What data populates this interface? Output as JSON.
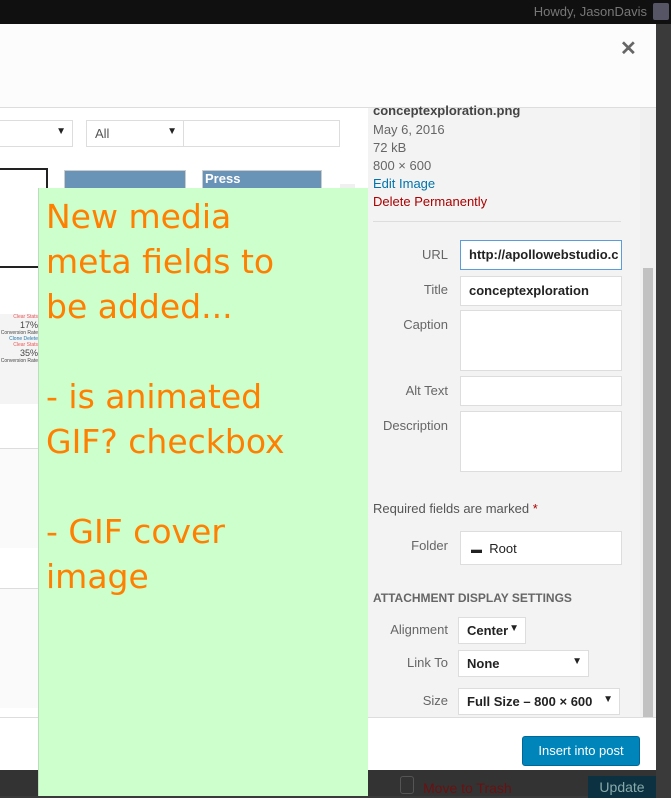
{
  "admin_bar": {
    "greeting": "Howdy, JasonDavis"
  },
  "filters": {
    "type_value": "",
    "date_value": "All",
    "search_placeholder": ""
  },
  "thumbnails": {
    "press_label": "Press",
    "stats": [
      {
        "clear": "Clear Stats",
        "pct": "17%",
        "sub": "Conversion Rate",
        "links": [
          "Clone",
          "Delete"
        ]
      },
      {
        "clear": "Clear Stats",
        "pct": "35%",
        "sub": "Conversion Rate"
      }
    ]
  },
  "details": {
    "filename": "conceptexploration.png",
    "date": "May 6, 2016",
    "size": "72 kB",
    "dimensions": "800 × 600",
    "edit_link": "Edit Image",
    "delete_link": "Delete Permanently"
  },
  "fields": {
    "url_label": "URL",
    "url_value": "http://apollowebstudio.c",
    "title_label": "Title",
    "title_value": "conceptexploration",
    "caption_label": "Caption",
    "alt_label": "Alt Text",
    "description_label": "Description",
    "required_note": "Required fields are marked",
    "required_star": "*",
    "folder_label": "Folder",
    "folder_value": "Root"
  },
  "display_settings": {
    "heading": "ATTACHMENT DISPLAY SETTINGS",
    "alignment_label": "Alignment",
    "alignment_value": "Center",
    "link_label": "Link To",
    "link_value": "None",
    "size_label": "Size",
    "size_value": "Full Size – 800 × 600"
  },
  "footer": {
    "insert_label": "Insert into post"
  },
  "background": {
    "trash_label": "Move to Trash",
    "update_label": "Update"
  },
  "note": {
    "text": "New media\nmeta fields to\nbe added...\n\n- is animated\nGIF? checkbox\n\n- GIF cover\nimage"
  },
  "colors": {
    "accent": "#0085ba",
    "delete": "#a00",
    "note_bg": "#ccffcc",
    "note_text": "#ff8000"
  }
}
